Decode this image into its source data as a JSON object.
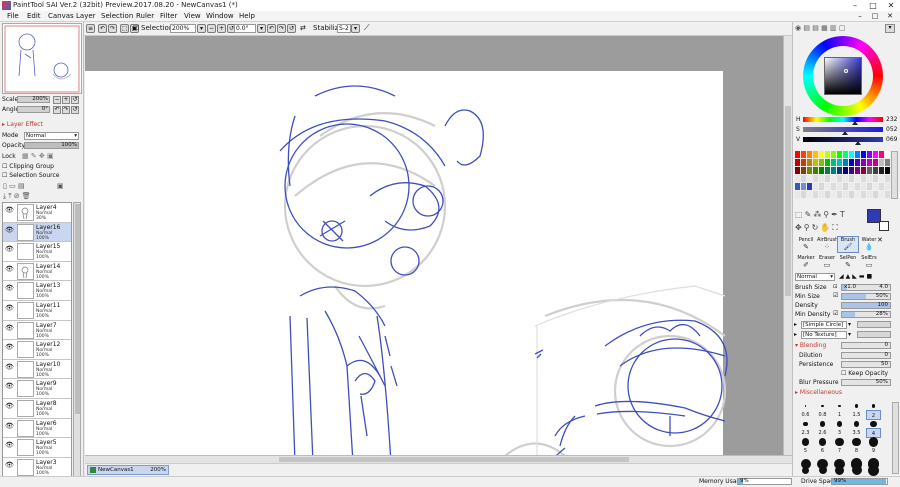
{
  "app": {
    "title": "PaintTool SAI Ver.2 (32bit) Preview.2017.08.20 - NewCanvas1 (*)",
    "window_controls": [
      "–",
      "□",
      "✕"
    ]
  },
  "menu": {
    "items": [
      "File",
      "Edit",
      "Canvas",
      "Layer",
      "Selection",
      "Ruler",
      "Filter",
      "View",
      "Window",
      "Help"
    ],
    "right_buttons": [
      "–",
      "□",
      "✕"
    ]
  },
  "toolbar": {
    "selection_label": "Selection",
    "zoom": "200%",
    "angle": "0.0°",
    "stabilizer_label": "Stabilizer",
    "stabilizer_value": "S-2"
  },
  "navigator": {
    "scale_label": "Scale",
    "scale_value": "200%",
    "angle_label": "Angle",
    "angle_value": "0°"
  },
  "layer_effect": {
    "header": "Layer Effect",
    "mode_label": "Mode",
    "mode_value": "Normal",
    "opacity_label": "Opacity",
    "opacity_value": "100%",
    "opacity_level": 1.0,
    "lock_label": "Lock",
    "clipping_group": "Clipping Group",
    "selection_source": "Selection Source"
  },
  "layers": [
    {
      "name": "Layer4",
      "mode": "Normal",
      "opacity": "30%",
      "selected": false,
      "has_art": true
    },
    {
      "name": "Layer16",
      "mode": "Normal",
      "opacity": "100%",
      "selected": true,
      "has_art": false
    },
    {
      "name": "Layer15",
      "mode": "Normal",
      "opacity": "100%",
      "selected": false,
      "has_art": false
    },
    {
      "name": "Layer14",
      "mode": "Normal",
      "opacity": "100%",
      "selected": false,
      "has_art": true
    },
    {
      "name": "Layer13",
      "mode": "Normal",
      "opacity": "100%",
      "selected": false,
      "has_art": false
    },
    {
      "name": "Layer11",
      "mode": "Normal",
      "opacity": "100%",
      "selected": false,
      "has_art": false
    },
    {
      "name": "Layer7",
      "mode": "Normal",
      "opacity": "100%",
      "selected": false,
      "has_art": false
    },
    {
      "name": "Layer12",
      "mode": "Normal",
      "opacity": "100%",
      "selected": false,
      "has_art": false
    },
    {
      "name": "Layer10",
      "mode": "Normal",
      "opacity": "100%",
      "selected": false,
      "has_art": false
    },
    {
      "name": "Layer9",
      "mode": "Normal",
      "opacity": "100%",
      "selected": false,
      "has_art": false
    },
    {
      "name": "Layer8",
      "mode": "Normal",
      "opacity": "100%",
      "selected": false,
      "has_art": false
    },
    {
      "name": "Layer6",
      "mode": "Normal",
      "opacity": "100%",
      "selected": false,
      "has_art": false
    },
    {
      "name": "Layer5",
      "mode": "Normal",
      "opacity": "100%",
      "selected": false,
      "has_art": false
    },
    {
      "name": "Layer3",
      "mode": "Normal",
      "opacity": "100%",
      "selected": false,
      "has_art": false
    }
  ],
  "color": {
    "current_hue_color": "#3a3acf",
    "h_label": "H",
    "h_value": "232",
    "h_level": 0.644,
    "s_label": "S",
    "s_value": "052",
    "s_level": 0.52,
    "v_label": "V",
    "v_value": "069",
    "v_level": 0.69,
    "primary_swatch": "#2e3bb5"
  },
  "tools": [
    {
      "label": "Pencil",
      "icon": "pencil-icon",
      "glyph": "✎"
    },
    {
      "label": "AirBrush",
      "icon": "airbrush-icon",
      "glyph": "⁘"
    },
    {
      "label": "Brush",
      "icon": "brush-icon",
      "glyph": "🖌"
    },
    {
      "label": "Water",
      "icon": "water-icon",
      "glyph": "💧"
    },
    {
      "label": "Marker",
      "icon": "marker-icon",
      "glyph": "✐"
    },
    {
      "label": "Eraser",
      "icon": "eraser-icon",
      "glyph": "▭"
    },
    {
      "label": "SelPen",
      "icon": "selpen-icon",
      "glyph": "✎"
    },
    {
      "label": "SelErs",
      "icon": "selers-icon",
      "glyph": "▭"
    }
  ],
  "brush": {
    "mode_value": "Normal",
    "size_label": "Brush Size",
    "size_multiplier": "x1.0",
    "size_value": "4.0",
    "min_size_label": "Min Size",
    "min_size_value": "50%",
    "min_size_level": 0.5,
    "density_label": "Density",
    "density_value": "100",
    "density_level": 1.0,
    "min_density_label": "Min Density",
    "min_density_value": "28%",
    "min_density_level": 0.28,
    "shape_value": "[Simple Circle]",
    "texture_value": "[No Texture]",
    "blending_header": "Blending",
    "blending_value": "0",
    "dilution_label": "Dilution",
    "dilution_value": "0",
    "persistence_label": "Persistence",
    "persistence_value": "50",
    "keep_opacity_label": "Keep Opacity",
    "blur_pressure_label": "Blur Pressure",
    "blur_pressure_value": "50%",
    "misc_header": "Miscellaneous"
  },
  "brush_sizes": {
    "row1": [
      "0.6",
      "0.8",
      "1",
      "1.5",
      "2"
    ],
    "row2": [
      "2.3",
      "2.6",
      "3",
      "3.5",
      "4"
    ],
    "row3": [
      "5",
      "6",
      "7",
      "8",
      "9"
    ],
    "row4": [
      "10",
      "12",
      "14",
      "16",
      "20"
    ]
  },
  "canvas_tabs": [
    {
      "name": "NewCanvas1",
      "zoom": "200%"
    }
  ],
  "status": {
    "memory_label": "Memory Usage",
    "memory_value": "9%",
    "memory_level": 0.09,
    "drive_label": "Drive Space",
    "drive_value": "99%",
    "drive_level": 0.99
  }
}
